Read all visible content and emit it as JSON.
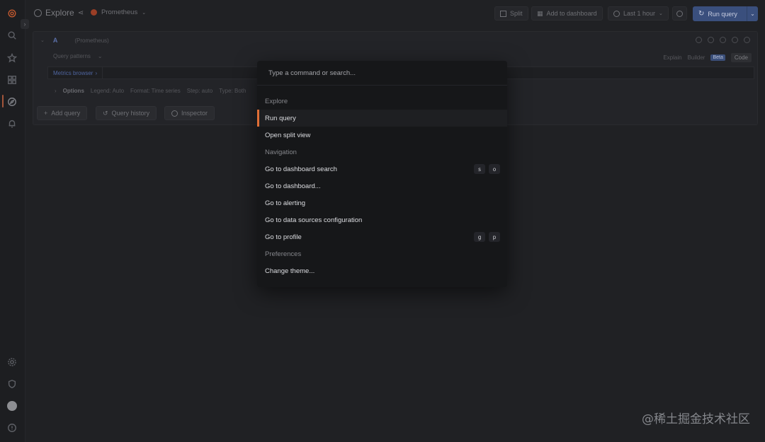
{
  "header": {
    "title": "Explore",
    "datasource": "Prometheus",
    "split_label": "Split",
    "add_to_dashboard_label": "Add to dashboard",
    "time_range_label": "Last 1 hour",
    "run_query_label": "Run query"
  },
  "query": {
    "ref_id": "A",
    "datasource_hint": "(Prometheus)",
    "patterns_label": "Query patterns",
    "metrics_browser_label": "Metrics browser",
    "mode_tabs": [
      "Explain",
      "Builder",
      "Beta",
      "Code"
    ],
    "options_label": "Options",
    "options": [
      "Legend: Auto",
      "Format: Time series",
      "Step: auto",
      "Type: Both"
    ]
  },
  "actions": {
    "add_query": "Add query",
    "query_history": "Query history",
    "inspector": "Inspector"
  },
  "palette": {
    "placeholder": "Type a command or search...",
    "items": [
      {
        "label": "Explore",
        "section": true
      },
      {
        "label": "Run query",
        "active": true
      },
      {
        "label": "Open split view"
      },
      {
        "label": "Navigation",
        "section": true
      },
      {
        "label": "Go to dashboard search",
        "keys": [
          "s",
          "o"
        ]
      },
      {
        "label": "Go to dashboard..."
      },
      {
        "label": "Go to alerting"
      },
      {
        "label": "Go to data sources configuration"
      },
      {
        "label": "Go to profile",
        "keys": [
          "g",
          "p"
        ]
      },
      {
        "label": "Preferences",
        "section": true
      },
      {
        "label": "Change theme..."
      }
    ]
  },
  "colors": {
    "accent": "#e06e36",
    "primary_button": "#3a4f7d",
    "background": "#202124",
    "palette_bg": "#161719"
  },
  "watermark": "@稀土掘金技术社区"
}
